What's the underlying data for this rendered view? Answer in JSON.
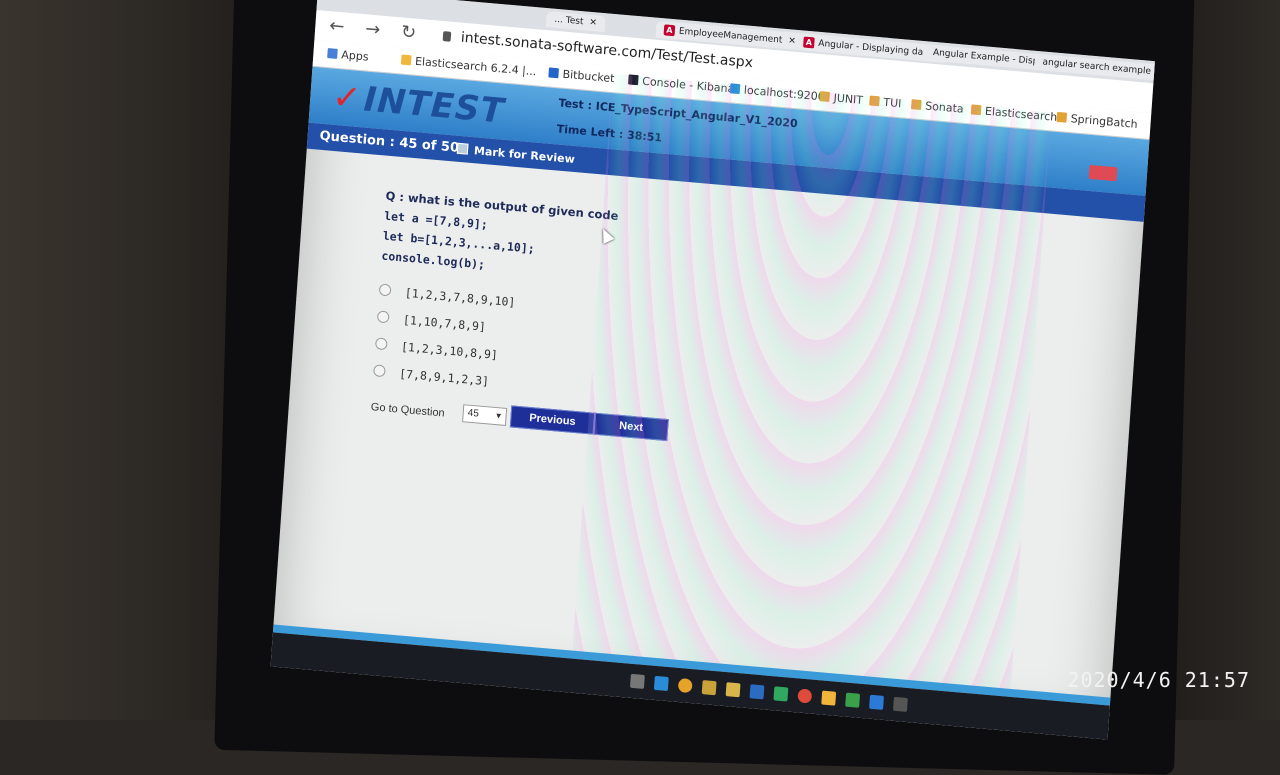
{
  "browser": {
    "tabs": [
      {
        "title": "... Test"
      },
      {
        "title": "EmployeeManagement"
      },
      {
        "title": "Angular - Displaying da"
      },
      {
        "title": "Angular Example - Disp"
      },
      {
        "title": "angular search example"
      }
    ],
    "url": "intest.sonata-software.com/Test/Test.aspx",
    "bookmarks": [
      "Apps",
      "Elasticsearch 6.2.4 |...",
      "Bitbucket",
      "Console - Kibana",
      "localhost:9200",
      "JUNIT",
      "TUI",
      "Sonata",
      "Elasticsearch",
      "SpringBatch"
    ]
  },
  "header": {
    "logo": "INTEST",
    "test_name": "Test : ICE_TypeScript_Angular_V1_2020",
    "time_left": "Time Left : 38:51"
  },
  "question_bar": {
    "number": "Question : 45 of 50",
    "mark_for_review": "Mark for Review"
  },
  "question": {
    "prompt": "Q :  what is the output of given code",
    "code": [
      "let a =[7,8,9];",
      "let b=[1,2,3,...a,10];",
      "console.log(b);"
    ],
    "options": [
      "[1,2,3,7,8,9,10]",
      "[1,10,7,8,9]",
      "[1,2,3,10,8,9]",
      "[7,8,9,1,2,3]"
    ]
  },
  "navigation": {
    "goto_label": "Go to Question",
    "goto_value": "45",
    "previous": "Previous",
    "next": "Next"
  },
  "photo_timestamp": "2020/4/6  21:57",
  "colors": {
    "header_blue": "#2f7fc9",
    "question_bar": "#2350a8",
    "button_navy": "#1f2f9a",
    "logo_check_red": "#e0252b"
  }
}
